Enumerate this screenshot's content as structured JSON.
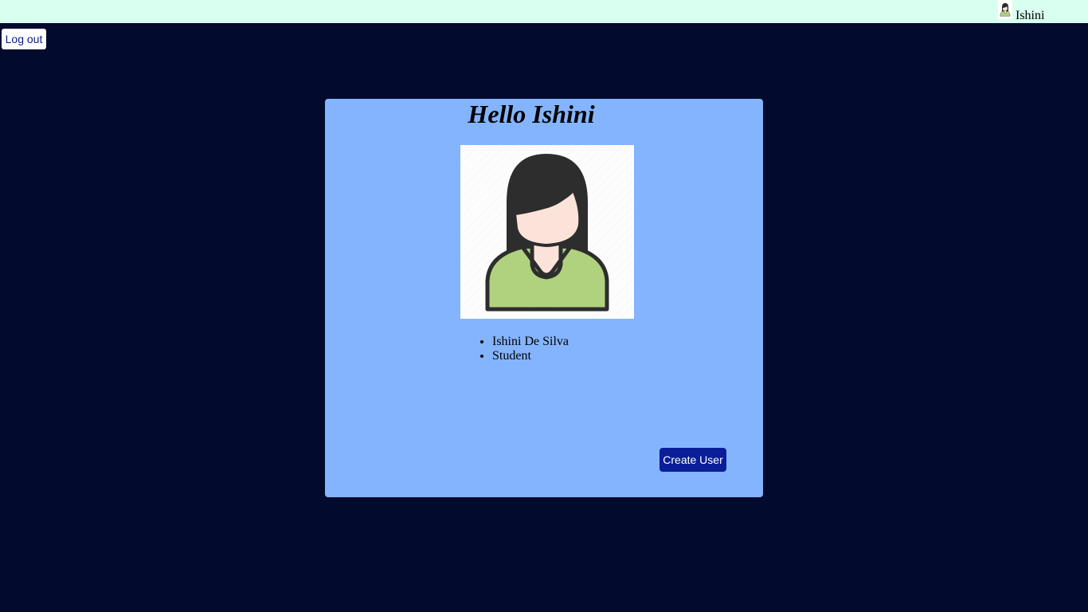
{
  "topbar": {
    "username": "Ishini",
    "avatar_icon": "female-avatar-icon"
  },
  "actions": {
    "logout_label": "Log out",
    "create_user_label": "Create User"
  },
  "profile": {
    "greeting": "Hello Ishini",
    "picture_icon": "female-avatar-icon",
    "details": [
      "Ishini De Silva",
      "Student"
    ]
  },
  "colors": {
    "page_background": "#020a2e",
    "topbar_background": "#d9fff0",
    "card_background": "#84b4fe",
    "primary_button": "#0a1e99",
    "avatar_hair": "#2d2d2d",
    "avatar_skin": "#fbe3da",
    "avatar_shirt": "#b0d27e"
  }
}
